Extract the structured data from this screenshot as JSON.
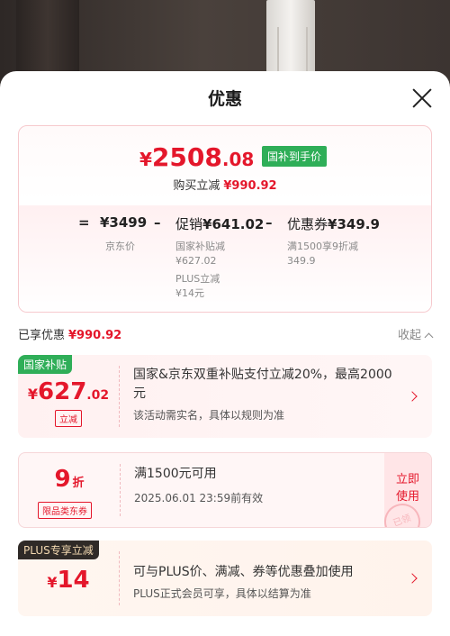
{
  "sheet": {
    "title": "优惠"
  },
  "summary": {
    "final_price_symbol": "¥",
    "final_price_int": "2508",
    "final_price_dec": ".08",
    "subsidy_tag": "国补到手价",
    "saved_label": "购买立减",
    "saved_amount": "¥990.92",
    "formula": {
      "eq": "=",
      "jd_price": "¥3499",
      "jd_price_label": "京东价",
      "minus1": "–",
      "promo_label": "促销",
      "promo_value": "¥641.02",
      "promo_sub1_label": "国家补贴减",
      "promo_sub1_value": "¥627.02",
      "promo_sub2_label": "PLUS立减",
      "promo_sub2_value": "¥14元",
      "minus2": "–",
      "coupon_label": "优惠券",
      "coupon_value": "¥349.9",
      "coupon_sub_label": "满1500享9折减",
      "coupon_sub_value": "349.9"
    }
  },
  "enjoyed": {
    "label": "已享优惠",
    "amount": "¥990.92",
    "collapse_label": "收起"
  },
  "coupons": [
    {
      "badge": "国家补贴",
      "symbol": "¥",
      "int": "627",
      "dec": ".02",
      "tag": "立减",
      "title": "国家&京东双重补贴支付立减20%，最高2000元",
      "desc": "该活动需实名，具体以规则为准"
    },
    {
      "int": "9",
      "unit": "折",
      "tag": "限品类东券",
      "title": "满1500元可用",
      "desc": "2025.06.01 23:59前有效",
      "use_label_1": "立即",
      "use_label_2": "使用",
      "stamp": "已领"
    },
    {
      "badge": "PLUS专享立减",
      "symbol": "¥",
      "int": "14",
      "title": "可与PLUS价、满减、券等优惠叠加使用",
      "desc": "PLUS正式会员可享，具体以结算为准"
    }
  ],
  "colors": {
    "accent": "#e4172b",
    "subsidy_green": "#2fae58",
    "plus_dark": "#2f2a27"
  }
}
